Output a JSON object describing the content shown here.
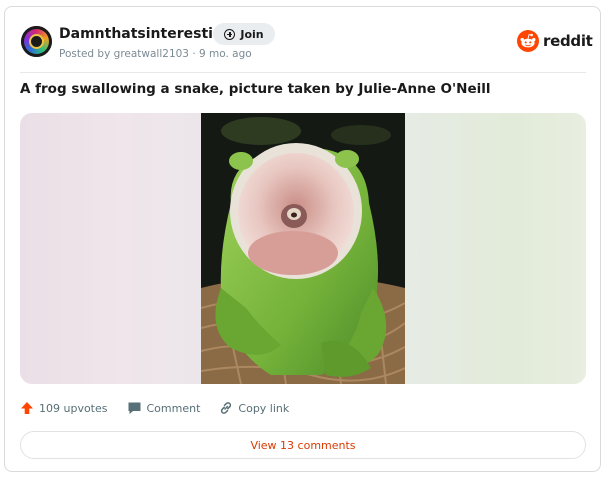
{
  "post": {
    "community": "Damnthatsinteresting",
    "join_label": "Join",
    "meta": "Posted by greatwall2103 · 9 mo. ago",
    "title": "A frog swallowing a snake, picture taken by Julie-Anne O'Neill",
    "image_alt": "Green tree frog with mouth wide open swallowing a snake"
  },
  "brand": {
    "name": "reddit",
    "color": "#ff4500"
  },
  "actions": {
    "upvotes": "109 upvotes",
    "comment": "Comment",
    "copy_link": "Copy link",
    "upvote_color": "#ff4500"
  },
  "comments_button": {
    "label": "View 13 comments",
    "color": "#d93a00"
  },
  "icons": {
    "avatar": "community-avatar",
    "join": "plus-circle-icon",
    "brand": "reddit-logo-icon",
    "upvote": "upvote-arrow-icon",
    "comment": "comment-bubble-icon",
    "link": "link-icon"
  }
}
